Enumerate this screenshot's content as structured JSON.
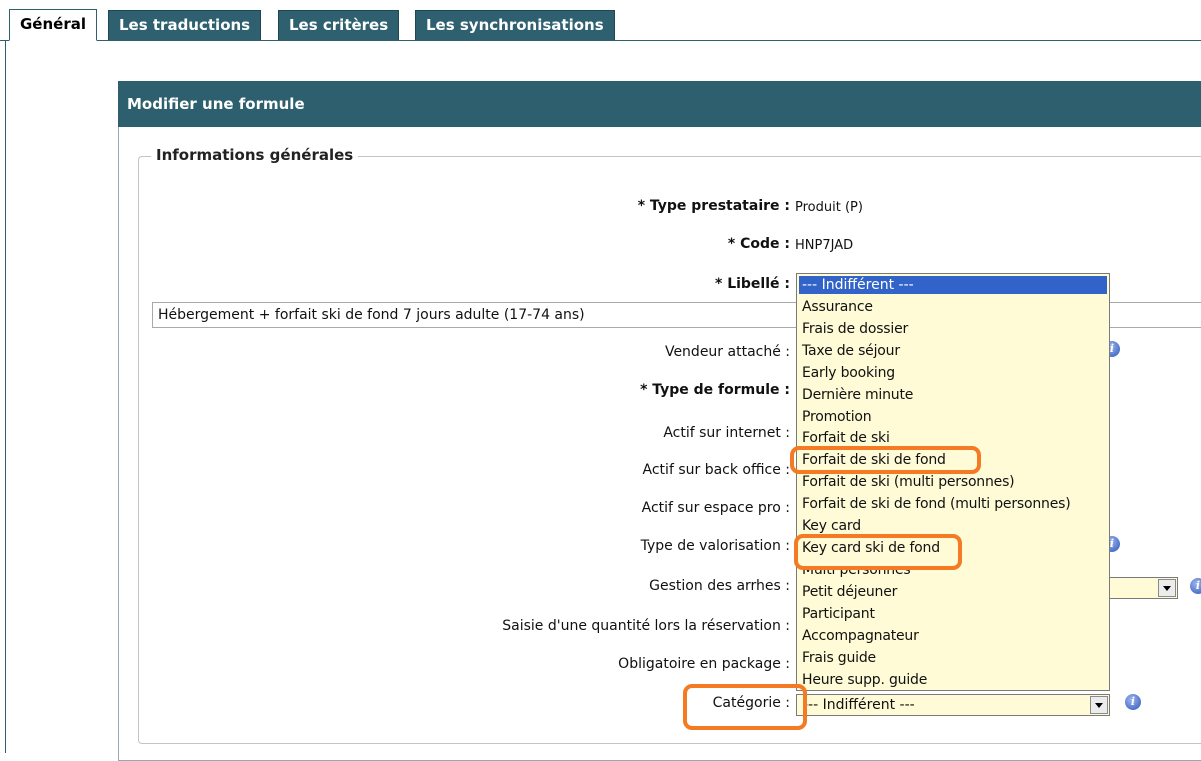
{
  "tabs": [
    "Général",
    "Les traductions",
    "Les critères",
    "Les synchronisations"
  ],
  "panel": {
    "title": "Modifier une formule",
    "legend": "Informations générales"
  },
  "fields": {
    "type_prestataire": {
      "label": "* Type prestataire :",
      "value": "Produit (P)"
    },
    "code": {
      "label": "* Code :",
      "value": "HNP7JAD"
    },
    "libelle": {
      "label": "* Libellé :",
      "value": "Hébergement + forfait ski de fond 7 jours adulte (17-74 ans)"
    },
    "vendeur": {
      "label": "Vendeur attaché :"
    },
    "type_formule": {
      "label": "* Type de formule :"
    },
    "actif_internet": {
      "label": "Actif sur internet :"
    },
    "actif_backoffice": {
      "label": "Actif sur back office :"
    },
    "actif_espace_pro": {
      "label": "Actif sur espace pro :"
    },
    "type_valorisation": {
      "label": "Type de valorisation :"
    },
    "gestion_arrhes": {
      "label": "Gestion des arrhes :"
    },
    "saisie_quantite": {
      "label": "Saisie d'une quantité lors la réservation :"
    },
    "obligatoire_package": {
      "label": "Obligatoire en package :"
    },
    "categorie": {
      "label": "Catégorie :",
      "value": "--- Indifférent ---"
    }
  },
  "dropdown": {
    "selected": "--- Indifférent ---",
    "items": [
      "Assurance",
      "Frais de dossier",
      "Taxe de séjour",
      "Early booking",
      "Dernière minute",
      "Promotion",
      "Forfait de ski",
      "Forfait de ski de fond",
      "Forfait de ski (multi personnes)",
      "Forfait de ski de fond (multi personnes)",
      "Key card",
      "Key card ski de fond",
      "Multi personnes",
      "Petit déjeuner",
      "Participant",
      "Accompagnateur",
      "Frais guide",
      "Heure supp. guide"
    ]
  },
  "colors": {
    "tab_bg": "#2f6070",
    "header_bg": "#2e5f6f",
    "select_bg": "#fffbd6",
    "selected_option_bg": "#3163c8",
    "annotation_highlight": "#f47a24"
  },
  "icons": [
    "info-icon",
    "chevron-down-icon"
  ]
}
